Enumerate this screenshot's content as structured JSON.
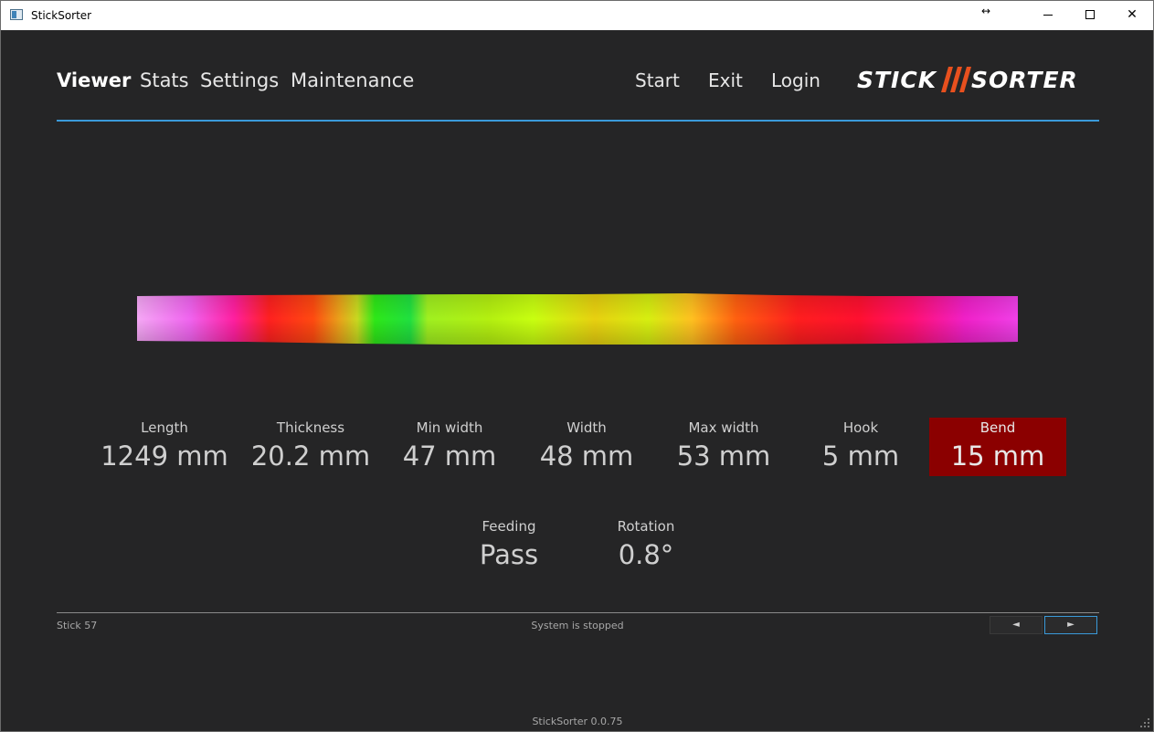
{
  "window": {
    "title": "StickSorter",
    "resize_glyph": "↔",
    "minimize_icon": "minimize-icon",
    "maximize_icon": "maximize-icon",
    "close_glyph": "✕"
  },
  "nav": {
    "tabs": [
      {
        "label": "Viewer",
        "active": true
      },
      {
        "label": "Stats",
        "active": false
      },
      {
        "label": "Settings",
        "active": false
      },
      {
        "label": "Maintenance",
        "active": false
      }
    ],
    "actions": {
      "start": "Start",
      "exit": "Exit",
      "login": "Login"
    }
  },
  "logo": {
    "left_word": "STICK",
    "right_word": "SORTER",
    "accent_color": "#e8501e"
  },
  "colors": {
    "background": "#252526",
    "accent_rule": "#3a9ad9",
    "alert_bg": "#8b0000"
  },
  "metrics": [
    {
      "label": "Length",
      "value": "1249 mm",
      "alert": false
    },
    {
      "label": "Thickness",
      "value": "20.2 mm",
      "alert": false
    },
    {
      "label": "Min width",
      "value": "47 mm",
      "alert": false
    },
    {
      "label": "Width",
      "value": "48 mm",
      "alert": false
    },
    {
      "label": "Max width",
      "value": "53 mm",
      "alert": false
    },
    {
      "label": "Hook",
      "value": "5 mm",
      "alert": false
    },
    {
      "label": "Bend",
      "value": "15 mm",
      "alert": true
    }
  ],
  "secondary_metrics": [
    {
      "label": "Feeding",
      "value": "Pass"
    },
    {
      "label": "Rotation",
      "value": "0.8°"
    }
  ],
  "footer": {
    "stick_id": "Stick 57",
    "status": "System is stopped",
    "prev_glyph": "◄",
    "next_glyph": "►",
    "version": "StickSorter 0.0.75"
  }
}
